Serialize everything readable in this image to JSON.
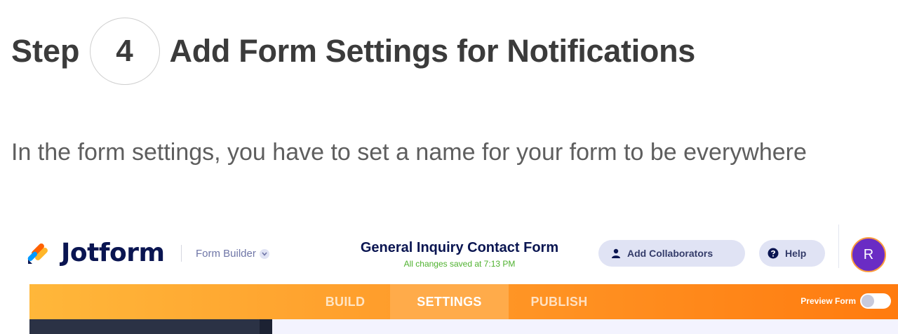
{
  "heading": {
    "step_word": "Step",
    "step_number": "4",
    "title": "Add Form Settings for Notifications"
  },
  "intro_text": "In the form settings, you have to set a name for your form to be everywhere",
  "app": {
    "logo_text": "Jotform",
    "builder_label": "Form Builder",
    "form_title": "General Inquiry Contact Form",
    "save_status": "All changes saved at 7:13 PM",
    "add_collaborators_label": "Add Collaborators",
    "help_label": "Help",
    "avatar_initial": "R",
    "tabs": [
      {
        "label": "BUILD",
        "active": false
      },
      {
        "label": "SETTINGS",
        "active": true
      },
      {
        "label": "PUBLISH",
        "active": false
      }
    ],
    "preview_label": "Preview Form",
    "preview_enabled": false
  },
  "colors": {
    "brand_navy": "#0a1551",
    "orange_start": "#ffb73a",
    "orange_end": "#ff7b0f",
    "save_green": "#4fb22f",
    "avatar_purple": "#6a2cc4"
  },
  "icons": {
    "logo": "jotform-logo-icon",
    "builder_dropdown": "chevron-down-icon",
    "collaborators": "user-icon",
    "help": "question-circle-icon"
  }
}
